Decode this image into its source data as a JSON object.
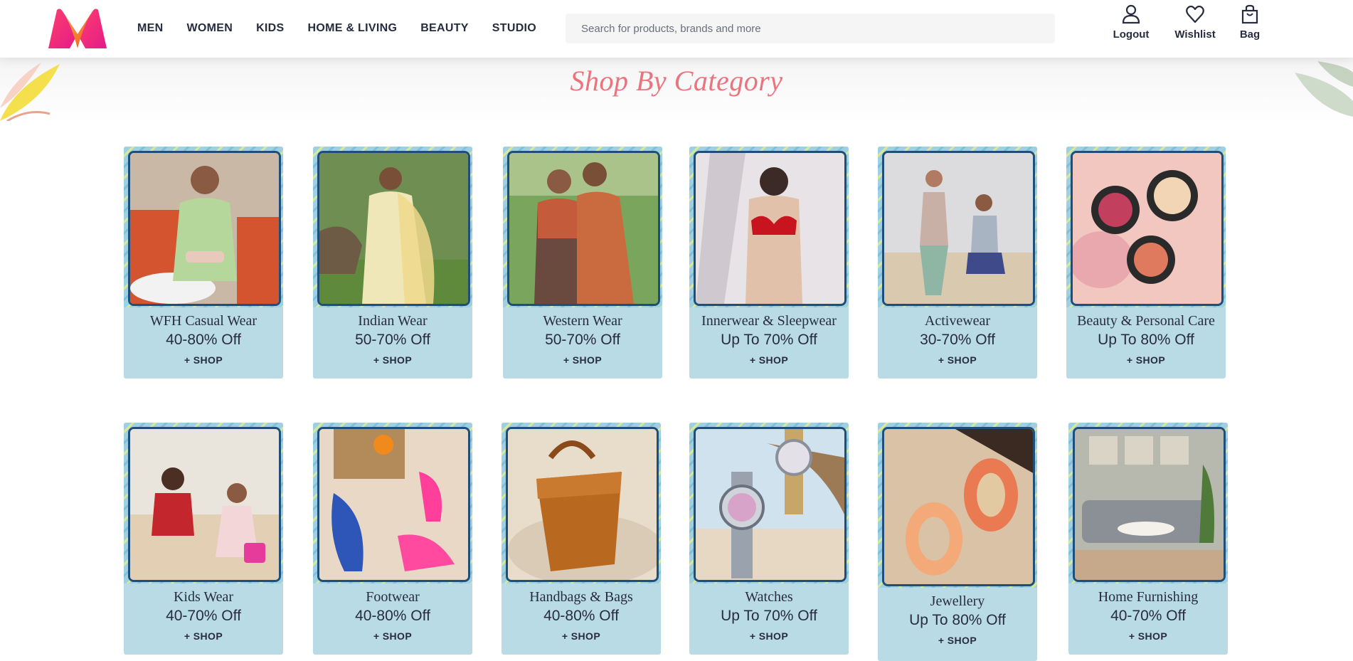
{
  "header": {
    "nav": [
      "MEN",
      "WOMEN",
      "KIDS",
      "HOME & LIVING",
      "BEAUTY",
      "STUDIO"
    ],
    "search_placeholder": "Search for products, brands and more",
    "actions": {
      "logout": "Logout",
      "wishlist": "Wishlist",
      "bag": "Bag"
    }
  },
  "section": {
    "title": "Shop By Category"
  },
  "categories": [
    {
      "name": "WFH Casual Wear",
      "offer": "40-80% Off",
      "cta": "+ SHOP"
    },
    {
      "name": "Indian Wear",
      "offer": "50-70% Off",
      "cta": "+ SHOP"
    },
    {
      "name": "Western Wear",
      "offer": "50-70% Off",
      "cta": "+ SHOP"
    },
    {
      "name": "Innerwear & Sleepwear",
      "offer": "Up To 70% Off",
      "cta": "+ SHOP"
    },
    {
      "name": "Activewear",
      "offer": "30-70% Off",
      "cta": "+ SHOP"
    },
    {
      "name": "Beauty & Personal Care",
      "offer": "Up To 80% Off",
      "cta": "+ SHOP"
    },
    {
      "name": "Kids Wear",
      "offer": "40-70% Off",
      "cta": "+ SHOP"
    },
    {
      "name": "Footwear",
      "offer": "40-80% Off",
      "cta": "+ SHOP"
    },
    {
      "name": "Handbags & Bags",
      "offer": "40-80% Off",
      "cta": "+ SHOP"
    },
    {
      "name": "Watches",
      "offer": "Up To 70% Off",
      "cta": "+ SHOP"
    },
    {
      "name": "Jewellery",
      "offer": "Up To 80% Off",
      "cta": "+ SHOP"
    },
    {
      "name": "Home Furnishing",
      "offer": "40-70% Off",
      "cta": "+ SHOP"
    }
  ],
  "colors": {
    "accent_title": "#e9747e",
    "card_bg": "#b8dbe6",
    "photo_border": "#1f4f78",
    "logo_pink": "#ff3f6c",
    "logo_orange": "#f57c20"
  }
}
